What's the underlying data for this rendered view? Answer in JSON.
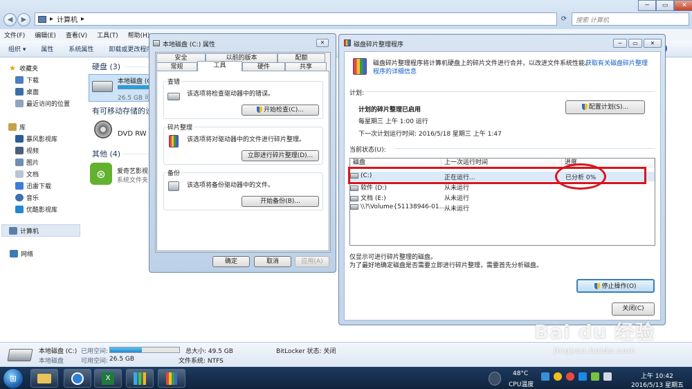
{
  "explorer": {
    "address": "计算机",
    "search_placeholder": "搜索 计算机",
    "menu": [
      "文件(F)",
      "编辑(E)",
      "查看(V)",
      "工具(T)",
      "帮助(H)"
    ],
    "toolbar": [
      "组织 ▾",
      "属性",
      "系统属性",
      "卸载或更改程序"
    ],
    "sidebar": {
      "favorites": "收藏夹",
      "favorite_items": [
        "下载",
        "桌面",
        "最近访问的位置"
      ],
      "libraries": "库",
      "library_items": [
        "暴风影视库",
        "视频",
        "图片",
        "文档",
        "迅雷下载",
        "音乐",
        "优酷影视库"
      ],
      "computer": "计算机",
      "network": "网络"
    },
    "groups": {
      "hdd": "硬盘 (3)",
      "hdd_item_name": "本地磁盘 (C",
      "hdd_item_free": "26.5 GB 可",
      "removable": "有可移动存储的设",
      "dvd": "DVD RW 驱",
      "other": "其他 (4)",
      "iqiyi": "爱奇艺影视",
      "iqiyi_sub": "系统文件夹"
    },
    "status": {
      "drive_name": "本地磁盘 (C:)",
      "drive_type": "本地磁盘",
      "used_label": "已用空间:",
      "free_label": "可用空间:",
      "free_value": "26.5 GB",
      "total_label": "总大小: 49.5 GB",
      "fs_label": "文件系统: NTFS",
      "bitlocker": "BitLocker 状态: 关闭",
      "used_fraction": 0.46
    }
  },
  "properties": {
    "title": "本地磁盘 (C:) 属性",
    "tabs_top": [
      "安全",
      "以前的版本",
      "配额"
    ],
    "tabs_bottom": [
      "常规",
      "工具",
      "硬件",
      "共享"
    ],
    "active_tab": "工具",
    "error_group": "查错",
    "error_desc": "该选项将检查驱动器中的错误。",
    "error_btn": "开始检查(C)...",
    "defrag_group": "碎片整理",
    "defrag_desc": "该选项将对驱动器中的文件进行碎片整理。",
    "defrag_btn": "立即进行碎片整理(D)...",
    "backup_group": "备份",
    "backup_desc": "该选项将备份驱动器中的文件。",
    "backup_btn": "开始备份(B)...",
    "ok": "确定",
    "cancel": "取消",
    "apply": "应用(A)"
  },
  "defrag": {
    "title": "磁盘碎片整理程序",
    "intro": "磁盘碎片整理程序将计算机硬盘上的碎片文件进行合并，以改进文件系统性能。",
    "intro_link_1": "获取有关磁盘碎片整理",
    "intro_link_2": "程序的详细信息",
    "schedule_label": "计划:",
    "schedule_on": "计划的碎片整理已启用",
    "schedule_when": "每星期三 上午 1:00 运行",
    "schedule_next": "下一次计划运行时间: 2016/5/18 星期三 上午 1:47",
    "config_btn": "配置计划(S)...",
    "current_label": "当前状态(U):",
    "columns": [
      "磁盘",
      "上一次运行时间",
      "进度"
    ],
    "rows": [
      {
        "disk": "(C:)",
        "last": "正在运行...",
        "progress": "已分析 0%"
      },
      {
        "disk": "软件 (D:)",
        "last": "从未运行",
        "progress": ""
      },
      {
        "disk": "文档 (E:)",
        "last": "从未运行",
        "progress": ""
      },
      {
        "disk": "\\\\?\\Volume{51138946-01...",
        "last": "从未运行",
        "progress": ""
      }
    ],
    "note1": "仅显示可进行碎片整理的磁盘。",
    "note2": "为了最好地确定磁盘是否需要立即进行碎片整理，需要首先分析磁盘。",
    "stop_btn": "停止操作(O)",
    "close_btn": "关闭(C)"
  },
  "taskbar": {
    "temp": "48°C",
    "temp_label": "CPU温度",
    "time": "上午 10:42",
    "date": "2016/5/13 星期五"
  },
  "watermark": {
    "brand": "Bai du 经验",
    "url": "jingyan.baidu.com"
  }
}
